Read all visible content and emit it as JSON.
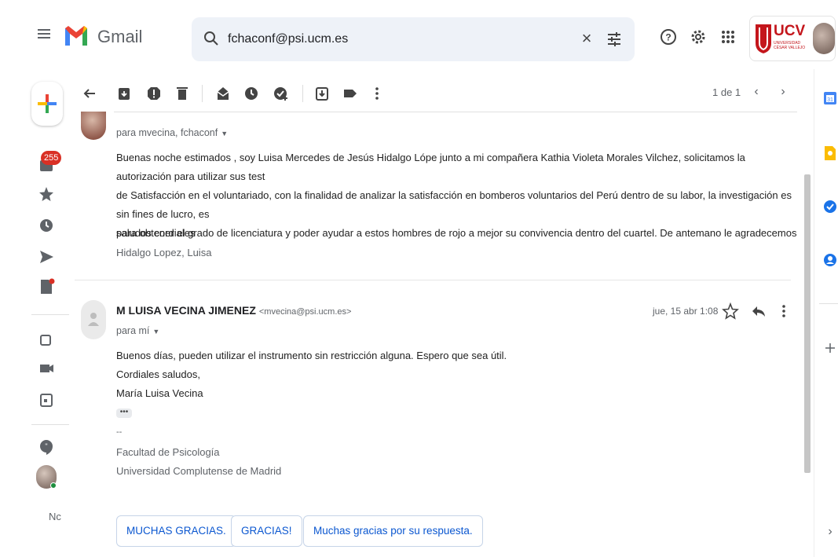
{
  "app": {
    "name": "Gmail"
  },
  "search": {
    "value": "fchaconf@psi.ucm.es"
  },
  "org": {
    "name": "UCV",
    "subtitle_line1": "UNIVERSIDAD",
    "subtitle_line2": "CÉSAR VALLEJO"
  },
  "rail": {
    "inbox_count": "255",
    "bottom_text": "Nc"
  },
  "pager": {
    "label": "1 de 1"
  },
  "message1": {
    "to_line": "para mvecina, fchaconf",
    "body_lines": [
      "Buenas noche estimados , soy Luisa Mercedes de Jesús Hidalgo Lópe junto a mi compañera  Kathia Violeta Morales Vilchez, solicitamos la autorización para utilizar sus test",
      "de Satisfacción en el voluntariado, con la finalidad de analizar la satisfacción en bomberos voluntarios del Perú dentro de su labor, la investigación es sin fines de lucro, es",
      "para obtener el grado de licenciatura y poder ayudar a estos hombres de rojo a mejor su convivencia dentro del cuartel. De antemano le agradecemos ."
    ],
    "closing": "saludos cordiales",
    "signature": "Hidalgo Lopez, Luisa"
  },
  "message2": {
    "sender_name": "M LUISA VECINA JIMENEZ",
    "sender_email": "<mvecina@psi.ucm.es>",
    "date": "jue, 15 abr 1:08",
    "to_line": "para mí",
    "body_lines": [
      "Buenos días, pueden utilizar el instrumento sin restricción alguna. Espero que sea útil.",
      "Cordiales saludos,",
      "María Luisa Vecina"
    ],
    "ellipsis": "•••",
    "sig_dash": "--",
    "sig_lines": [
      "Facultad de Psicología",
      "Universidad Complutense de Madrid"
    ]
  },
  "smart_replies": [
    "MUCHAS GRACIAS.",
    "GRACIAS!",
    "Muchas gracias por su respuesta."
  ],
  "colors": {
    "accent": "#0b57d0",
    "badge": "#d93025",
    "org_red": "#c4161c"
  }
}
